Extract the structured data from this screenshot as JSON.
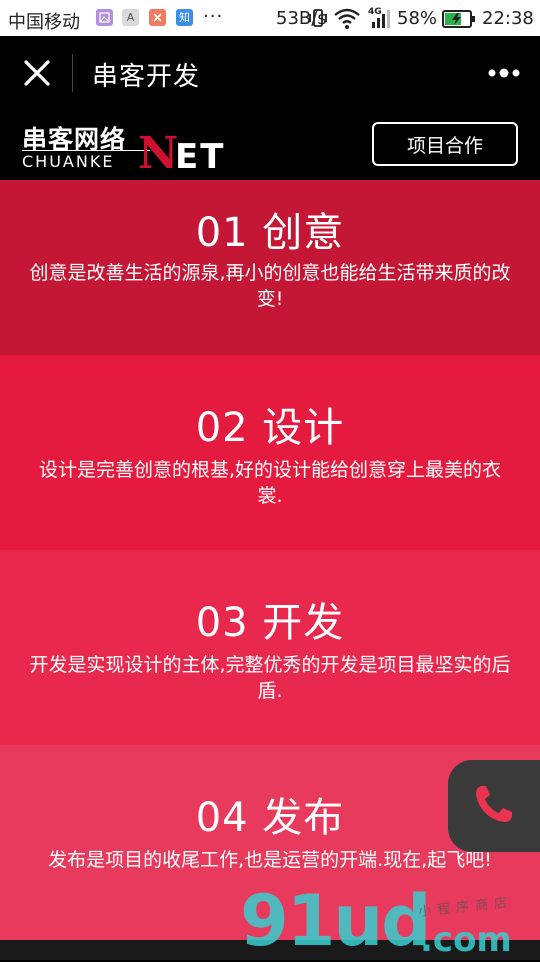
{
  "status_bar": {
    "carrier": "中国移动",
    "app_icons": [
      {
        "name": "gallery-app-icon",
        "glyph": "",
        "color": "#b58ee0"
      },
      {
        "name": "font-app-icon",
        "glyph": "A",
        "color": "#d9d9d9"
      },
      {
        "name": "tools-app-icon",
        "glyph": "",
        "color": "#f07a60"
      },
      {
        "name": "zhihu-app-icon",
        "glyph": "知",
        "color": "#3a8ee6"
      }
    ],
    "more": "···",
    "speed": "53B/s",
    "network_type": "4G",
    "battery": "58%",
    "time": "22:38"
  },
  "nav": {
    "title": "串客开发"
  },
  "brand": {
    "logo_cn": "串客网络",
    "logo_en": "CHUANKE",
    "logo_n": "N",
    "logo_et": "ET",
    "cooperate_button": "项目合作"
  },
  "sections": [
    {
      "heading": "01 创意",
      "text": "创意是改善生活的源泉,再小的创意也能给生活带来质的改变!",
      "color": "#c41735"
    },
    {
      "heading": "02 设计",
      "text": "设计是完善创意的根基,好的设计能给创意穿上最美的衣裳.",
      "color": "#e41b3f"
    },
    {
      "heading": "03 开发",
      "text": "开发是实现设计的主体,完整优秀的开发是项目最坚实的后盾.",
      "color": "#e8284d"
    },
    {
      "heading": "04 发布",
      "text": "发布是项目的收尾工作,也是运营的开端.现在,起飞吧!",
      "color": "#e73a5c"
    }
  ],
  "watermark": {
    "main": "91ud",
    "suffix": ".com",
    "small": "小程序商店"
  },
  "colors": {
    "accent": "#d0102f",
    "black": "#000000"
  }
}
